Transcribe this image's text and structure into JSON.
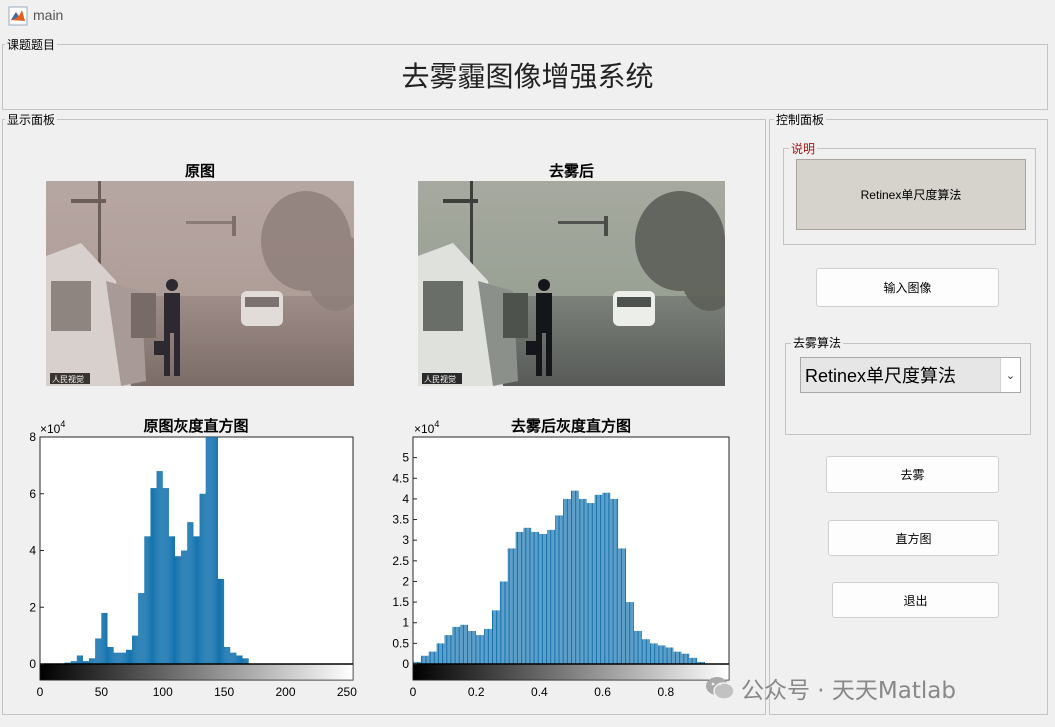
{
  "window": {
    "title": "main"
  },
  "topic_panel": {
    "label": "课题题目",
    "title": "去雾霾图像增强系统"
  },
  "display_panel": {
    "label": "显示面板",
    "original_title": "原图",
    "dehazed_title": "去雾后",
    "watermark_left": "人民视觉",
    "watermark_left2": "人民视觉",
    "hist1_title": "原图灰度直方图",
    "hist2_title": "去雾后灰度直方图"
  },
  "control_panel": {
    "label": "控制面板",
    "desc_label": "说明",
    "desc_text": "Retinex单尺度算法",
    "input_button": "输入图像",
    "algo_label": "去雾算法",
    "algo_selected": "Retinex单尺度算法",
    "dehaze_button": "去雾",
    "hist_button": "直方图",
    "exit_button": "退出"
  },
  "watermark": {
    "text": "公众号 · 天天Matlab"
  },
  "colors": {
    "bar": "#1372ae",
    "desc_bg": "#d6d2cc",
    "label_red": "#a31515"
  },
  "chart_data": [
    {
      "type": "bar",
      "title": "原图灰度直方图",
      "xlim": [
        0,
        255
      ],
      "ylim": [
        0,
        80000
      ],
      "y_multiplier": "×10^4",
      "xticks": [
        "0",
        "50",
        "100",
        "150",
        "200",
        "250"
      ],
      "yticks": [
        "0",
        "2",
        "4",
        "6",
        "8"
      ],
      "x": [
        0,
        5,
        10,
        15,
        20,
        25,
        30,
        35,
        40,
        45,
        50,
        55,
        60,
        65,
        70,
        75,
        80,
        85,
        90,
        95,
        100,
        105,
        110,
        115,
        120,
        125,
        130,
        135,
        140,
        145,
        150,
        155,
        160,
        165,
        170
      ],
      "values": [
        0,
        0,
        0,
        0,
        500,
        1000,
        3000,
        1000,
        2000,
        9000,
        18000,
        6000,
        4000,
        4000,
        5000,
        10000,
        25000,
        45000,
        62000,
        68000,
        62000,
        45000,
        38000,
        40000,
        50000,
        45000,
        60000,
        80000,
        95000,
        30000,
        6000,
        4000,
        3000,
        2000,
        0
      ]
    },
    {
      "type": "bar",
      "title": "去雾后灰度直方图",
      "xlim": [
        0,
        1
      ],
      "ylim": [
        0,
        55000
      ],
      "y_multiplier": "×10^4",
      "xticks": [
        "0",
        "0.2",
        "0.4",
        "0.6",
        "0.8",
        "1"
      ],
      "yticks": [
        "0",
        "0.5",
        "1",
        "1.5",
        "2",
        "2.5",
        "3",
        "3.5",
        "4",
        "4.5",
        "5"
      ],
      "x": [
        0,
        0.025,
        0.05,
        0.075,
        0.1,
        0.125,
        0.15,
        0.175,
        0.2,
        0.225,
        0.25,
        0.275,
        0.3,
        0.325,
        0.35,
        0.375,
        0.4,
        0.425,
        0.45,
        0.475,
        0.5,
        0.525,
        0.55,
        0.575,
        0.6,
        0.625,
        0.65,
        0.675,
        0.7,
        0.725,
        0.75,
        0.775,
        0.8,
        0.825,
        0.85,
        0.875,
        0.9,
        0.925
      ],
      "values": [
        500,
        2000,
        3000,
        5000,
        7000,
        9000,
        9500,
        8000,
        7000,
        8500,
        13000,
        20000,
        28000,
        32000,
        33000,
        32000,
        31500,
        32500,
        36000,
        40000,
        42000,
        40000,
        39000,
        41000,
        41500,
        40000,
        28000,
        15000,
        8000,
        6000,
        5000,
        4500,
        4000,
        3000,
        2500,
        1500,
        500,
        0
      ]
    }
  ]
}
